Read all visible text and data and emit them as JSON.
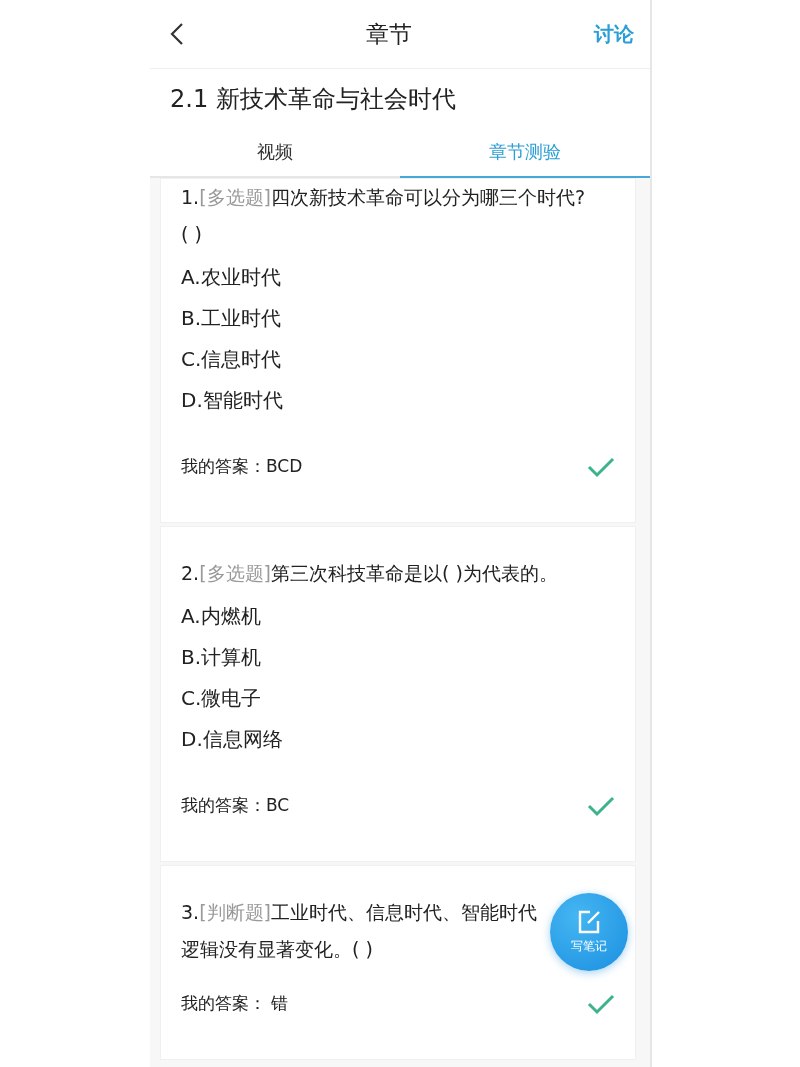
{
  "header": {
    "title": "章节",
    "action": "讨论"
  },
  "chapter_title": "2.1 新技术革命与社会时代",
  "tabs": [
    {
      "label": "视频",
      "selected": false
    },
    {
      "label": "章节测验",
      "selected": true
    }
  ],
  "questions": [
    {
      "number": "1.",
      "type_label": "[多选题]",
      "text": "四次新技术革命可以分为哪三个时代?( )",
      "options": [
        "A.农业时代",
        "B.工业时代",
        "C.信息时代",
        "D.智能时代"
      ],
      "answer": "我的答案：BCD",
      "correct": true
    },
    {
      "number": "2.",
      "type_label": "[多选题]",
      "text": "第三次科技革命是以( )为代表的。",
      "options": [
        "A.内燃机",
        "B.计算机",
        "C.微电子",
        "D.信息网络"
      ],
      "answer": "我的答案：BC",
      "correct": true
    },
    {
      "number": "3.",
      "type_label": "[判断题]",
      "text": "工业时代、信息时代、智能时代",
      "continuation": "逻辑没有显著变化。( )",
      "answer": "我的答案： 错",
      "correct": true
    }
  ],
  "fab": {
    "label": "写笔记"
  }
}
